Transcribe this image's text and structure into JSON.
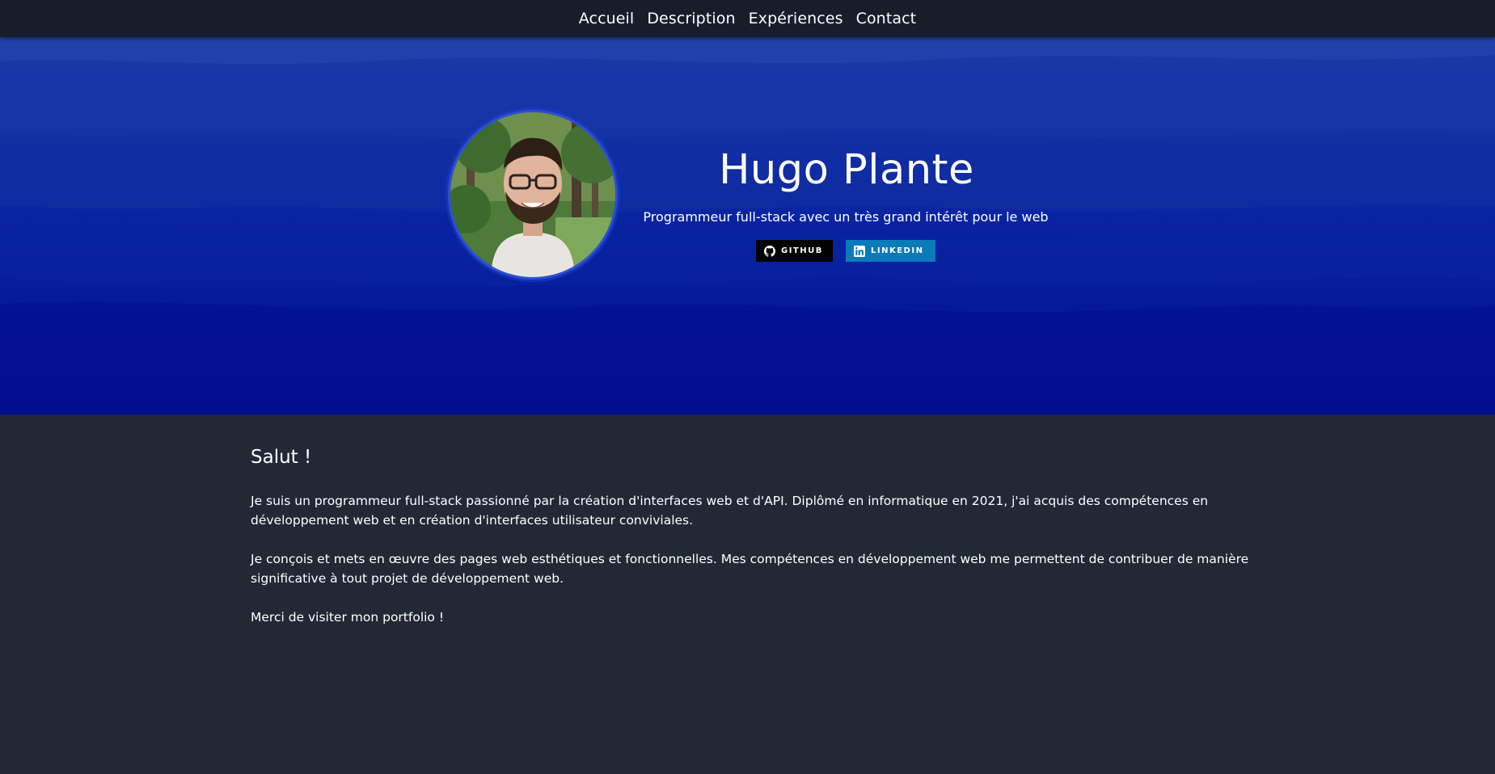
{
  "nav": {
    "items": [
      {
        "label": "Accueil"
      },
      {
        "label": "Description"
      },
      {
        "label": "Expériences"
      },
      {
        "label": "Contact"
      }
    ]
  },
  "hero": {
    "name": "Hugo Plante",
    "subtitle": "Programmeur full-stack avec un très grand intérêt pour le web",
    "social": {
      "github_label": "GITHUB",
      "linkedin_label": "LINKEDIN"
    }
  },
  "about": {
    "heading": "Salut !",
    "paragraphs": [
      "Je suis un programmeur full-stack passionné par la création d'interfaces web et d'API. Diplômé en informatique en 2021, j'ai acquis des compétences en développement web et en création d'interfaces utilisateur conviviales.",
      "Je conçois et mets en œuvre des pages web esthétiques et fonctionnelles. Mes compétences en développement web me permettent de contribuer de manière significative à tout projet de développement web.",
      "Merci de visiter mon portfolio !"
    ]
  },
  "colors": {
    "navbar_bg": "#171d2b",
    "page_bg": "#212936",
    "hero_top": "#1c3aa6",
    "hero_bottom": "#020d8c",
    "github_badge": "#000000",
    "linkedin_badge": "#0a7bb8"
  },
  "icons": {
    "github": "github-icon",
    "linkedin": "linkedin-icon"
  }
}
